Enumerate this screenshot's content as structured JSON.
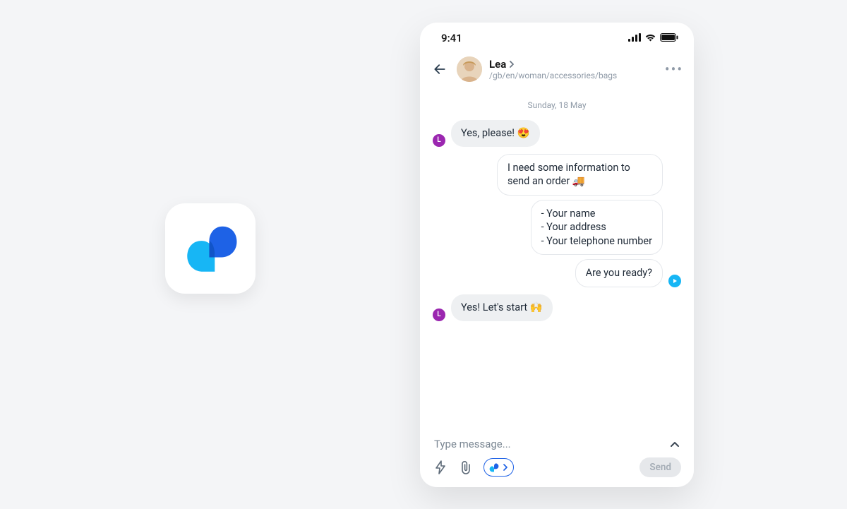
{
  "status": {
    "time": "9:41"
  },
  "header": {
    "name": "Lea",
    "path": "/gb/en/woman/accessories/bags",
    "avatar_initial": "L"
  },
  "date_separator": "Sunday, 18 May",
  "contact_initial": "L",
  "messages": {
    "m0": {
      "text": "Yes, please! 😍"
    },
    "m1": {
      "text": "I need some information to send an order 🚚"
    },
    "m2": {
      "lines": [
        "- Your name",
        "- Your address",
        "- Your telephone number"
      ]
    },
    "m3": {
      "text": "Are you ready?"
    },
    "m4": {
      "text": "Yes! Let's start 🙌"
    }
  },
  "composer": {
    "placeholder": "Type message...",
    "send_label": "Send"
  }
}
